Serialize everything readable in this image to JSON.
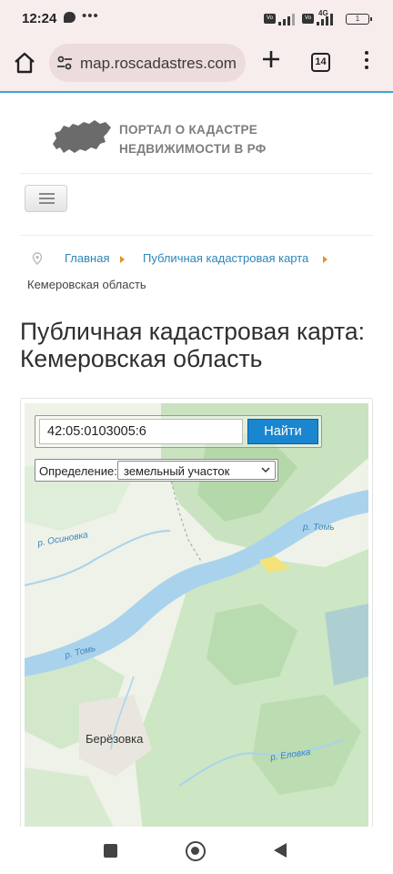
{
  "status_bar": {
    "time": "12:24",
    "battery": "1",
    "network_label": "4G"
  },
  "browser": {
    "url": "map.roscadastres.com",
    "tab_count": "14",
    "accent_color": "#3aa4d6"
  },
  "site": {
    "logo_line1": "ПОРТАЛ О КАДАСТРЕ",
    "logo_line2": "НЕДВИЖИМОСТИ В РФ"
  },
  "breadcrumb": {
    "items": [
      "Главная",
      "Публичная кадастровая карта"
    ],
    "current": "Кемеровская область"
  },
  "page": {
    "title": "Публичная кадастровая карта: Кемеровская область"
  },
  "map": {
    "search_value": "42:05:0103005:6",
    "search_button": "Найти",
    "definition_label": "Определение:",
    "definition_value": "земельный участок",
    "labels": {
      "osinovka": "р. Осиновка",
      "tom_right": "р. Томь",
      "tom_left": "р. Томь",
      "elovka": "р. Еловка",
      "town": "Берёзовка"
    }
  },
  "icons": [
    "home-icon",
    "site-settings-icon",
    "new-tab-icon",
    "tab-switcher-icon",
    "overflow-menu-icon",
    "map-pin-icon",
    "hamburger-icon"
  ]
}
